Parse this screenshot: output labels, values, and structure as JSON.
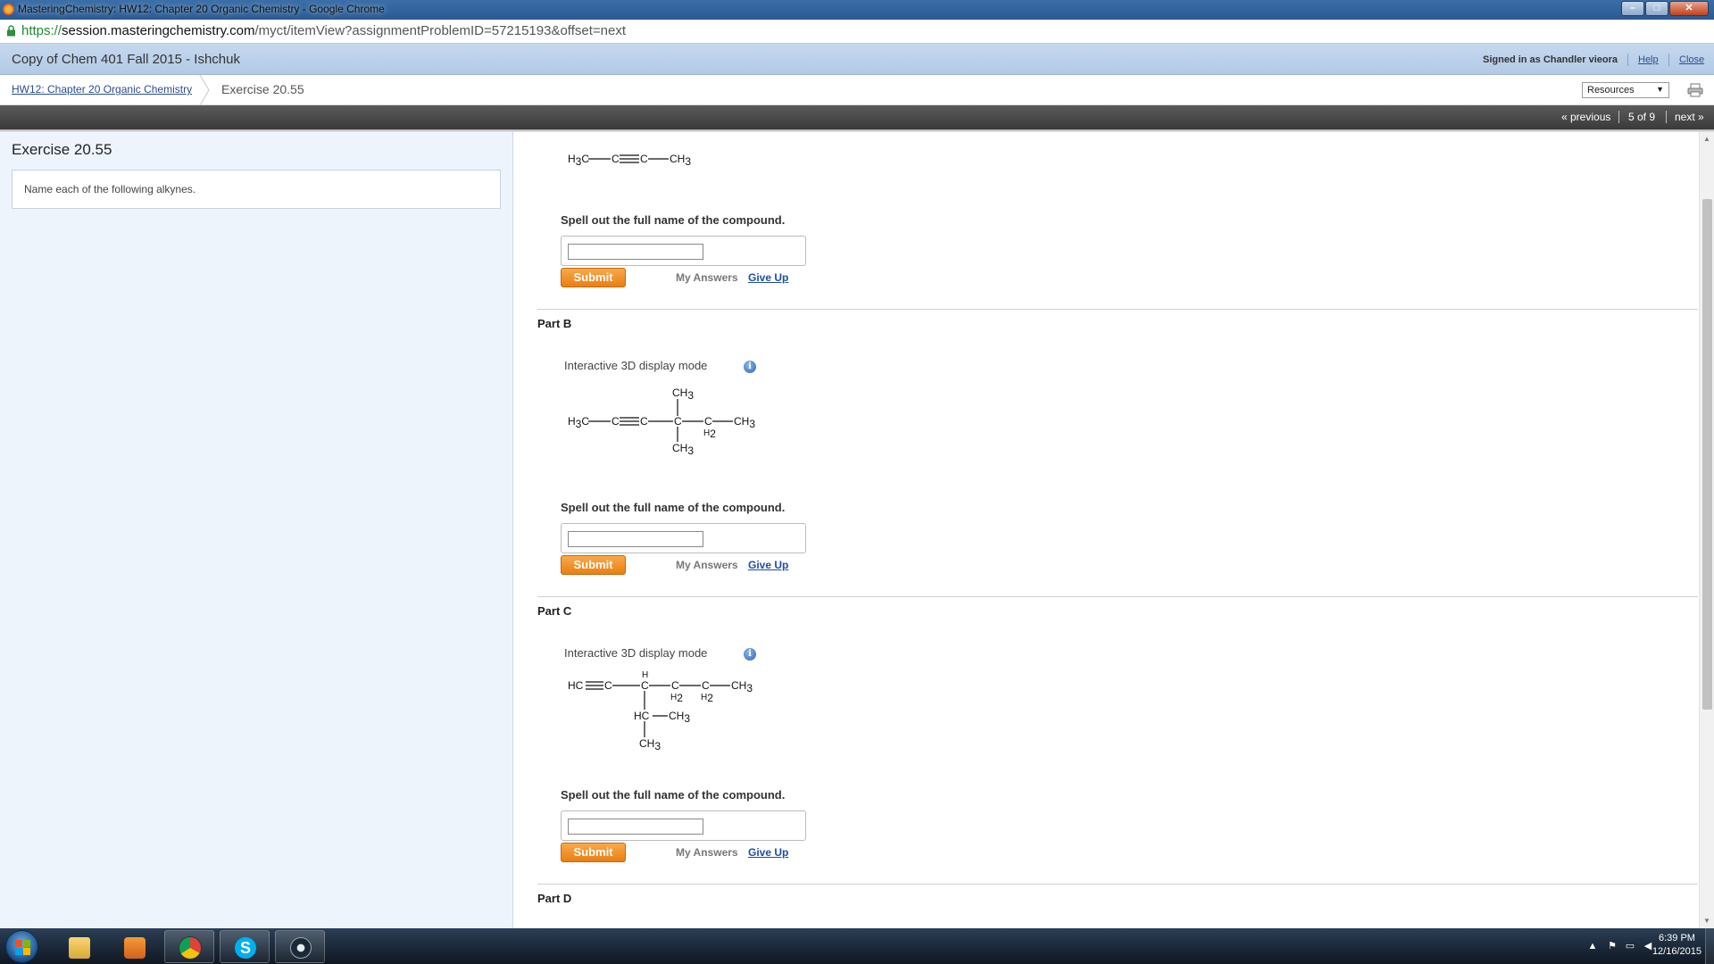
{
  "window": {
    "title": "MasteringChemistry: HW12: Chapter 20 Organic Chemistry - Google Chrome"
  },
  "address_bar": {
    "url_scheme": "https://",
    "url_host": "session.masteringchemistry.com",
    "url_path": "/myct/itemView?assignmentProblemID=57215193&offset=next"
  },
  "header": {
    "course_title": "Copy of Chem 401 Fall 2015 - Ishchuk",
    "signed_in": "Signed in as Chandler vieora",
    "help_label": "Help",
    "close_label": "Close"
  },
  "breadcrumb": {
    "assignment": "HW12: Chapter 20 Organic Chemistry",
    "current": "Exercise 20.55",
    "resources_label": "Resources"
  },
  "nav": {
    "previous": "« previous",
    "position": "5 of 9",
    "next": "next »"
  },
  "left_panel": {
    "title": "Exercise 20.55",
    "instructions": "Name each of the following alkynes."
  },
  "parts": {
    "a": {
      "prompt": "Spell out the full name of the compound.",
      "answer": "",
      "submit": "Submit",
      "my_answers": "My Answers",
      "give_up": "Give Up",
      "molecule": {
        "h3c": "H",
        "h3c_sub": "3",
        "h3c_c": "C",
        "c1": "C",
        "c2": "C",
        "ch3": "CH",
        "ch3_sub": "3"
      }
    },
    "b": {
      "title": "Part B",
      "display_mode": "Interactive 3D display mode",
      "prompt": "Spell out the full name of the compound.",
      "answer": "",
      "submit": "Submit",
      "my_answers": "My Answers",
      "give_up": "Give Up",
      "molecule": {
        "h3c": "H",
        "sub3": "3",
        "c": "C",
        "ch": "CH",
        "h": "H",
        "sub2": "2"
      }
    },
    "c": {
      "title": "Part C",
      "display_mode": "Interactive 3D display mode",
      "prompt": "Spell out the full name of the compound.",
      "answer": "",
      "submit": "Submit",
      "my_answers": "My Answers",
      "give_up": "Give Up",
      "molecule": {
        "hc": "HC",
        "c": "C",
        "h": "H",
        "ch": "CH",
        "sub3": "3",
        "sub2": "2"
      }
    },
    "d": {
      "title": "Part D"
    }
  },
  "info_icon_glyph": "i",
  "taskbar": {
    "time": "6:39 PM",
    "date": "12/16/2015"
  },
  "colors": {
    "submit_orange": "#ea7f12",
    "header_blue": "#b2c9e6",
    "left_panel_bg": "#eef4fc",
    "link_blue": "#2a4d8f"
  }
}
